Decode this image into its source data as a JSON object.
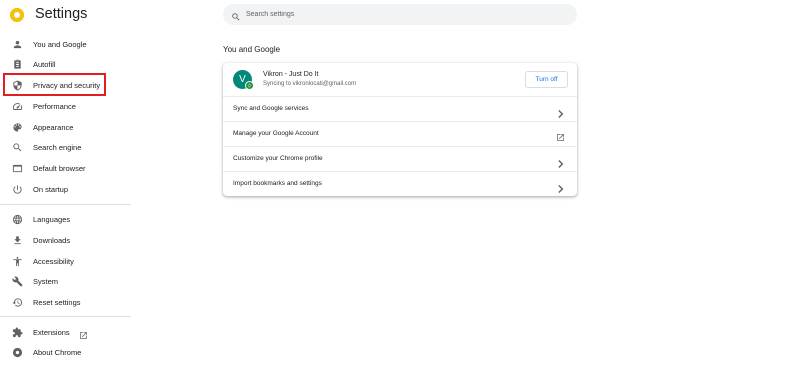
{
  "app": {
    "title": "Settings"
  },
  "search": {
    "placeholder": "Search settings"
  },
  "sidebar": {
    "items": [
      {
        "label": "You and Google",
        "icon": "person-icon"
      },
      {
        "label": "Autofill",
        "icon": "clipboard-icon"
      },
      {
        "label": "Privacy and security",
        "icon": "shield-icon",
        "highlighted": true
      },
      {
        "label": "Performance",
        "icon": "speedometer-icon"
      },
      {
        "label": "Appearance",
        "icon": "palette-icon"
      },
      {
        "label": "Search engine",
        "icon": "search-icon"
      },
      {
        "label": "Default browser",
        "icon": "browser-icon"
      },
      {
        "label": "On startup",
        "icon": "power-icon"
      },
      {
        "label": "Languages",
        "icon": "globe-icon"
      },
      {
        "label": "Downloads",
        "icon": "download-icon"
      },
      {
        "label": "Accessibility",
        "icon": "accessibility-icon"
      },
      {
        "label": "System",
        "icon": "wrench-icon"
      },
      {
        "label": "Reset settings",
        "icon": "reset-icon"
      },
      {
        "label": "Extensions",
        "icon": "puzzle-icon"
      },
      {
        "label": "About Chrome",
        "icon": "chrome-icon"
      }
    ]
  },
  "main": {
    "section_title": "You and Google",
    "profile": {
      "avatar_letter": "V",
      "name": "Vikron - Just Do It",
      "status": "Syncing to vikronlocati@gmail.com",
      "turn_off_label": "Turn off"
    },
    "rows": [
      {
        "label": "Sync and Google services",
        "trailing": "chevron-right-icon"
      },
      {
        "label": "Manage your Google Account",
        "trailing": "external-link-icon"
      },
      {
        "label": "Customize your Chrome profile",
        "trailing": "chevron-right-icon"
      },
      {
        "label": "Import bookmarks and settings",
        "trailing": "chevron-right-icon"
      }
    ]
  },
  "colors": {
    "accent": "#1a73e8",
    "highlight_box": "#e02020",
    "avatar": "#00897b",
    "sync_badge": "#1e8e3e"
  }
}
